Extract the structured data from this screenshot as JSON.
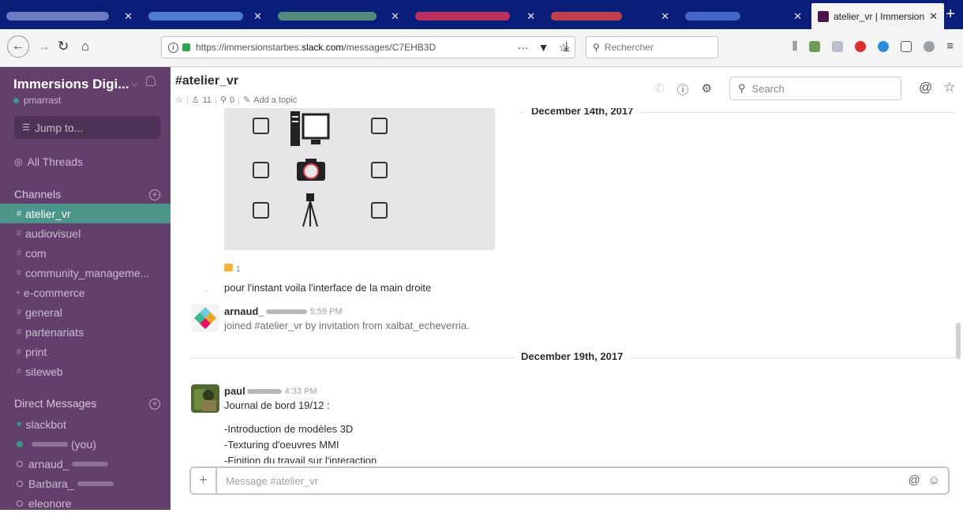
{
  "browser": {
    "active_tab_title": "atelier_vr | Immersion",
    "url_prefix": "https://immersionstarbes.",
    "url_host": "slack.com",
    "url_path": "/messages/C7EHB3D",
    "search_placeholder": "Rechercher"
  },
  "sidebar": {
    "team_name": "Immersions Digi...",
    "username": "pmarrast",
    "jump_label": "Jump to...",
    "threads_label": "All Threads",
    "channels_heading": "Channels",
    "channels": [
      {
        "name": "atelier_vr"
      },
      {
        "name": "audiovisuel"
      },
      {
        "name": "com"
      },
      {
        "name": "community_manageme..."
      },
      {
        "name": "e-commerce"
      },
      {
        "name": "general"
      },
      {
        "name": "partenariats"
      },
      {
        "name": "print"
      },
      {
        "name": "siteweb"
      }
    ],
    "dm_heading": "Direct Messages",
    "dms": [
      {
        "name": "slackbot"
      },
      {
        "name": "(you)"
      },
      {
        "name": "arnaud_"
      },
      {
        "name": "Barbara_"
      },
      {
        "name": "eleonore"
      }
    ]
  },
  "channel": {
    "title": "#atelier_vr",
    "members": "11",
    "pins": "0",
    "topic_label": "Add a topic",
    "search_placeholder": "Search"
  },
  "messages": {
    "divider_1": "December 14th, 2017",
    "reaction_count": "1",
    "text_1": "pour l'instant voila l'interface de la main droite",
    "msg_2": {
      "author": "arnaud_",
      "time": "5:59 PM",
      "text": "joined #atelier_vr by invitation from xalbat_echeverria."
    },
    "divider_2": "December 19th, 2017",
    "msg_3": {
      "author": "paul",
      "time": "4:33 PM",
      "line_1": "Journal de bord 19/12 :",
      "line_2": "-Introduction de modèles 3D",
      "line_3": "-Texturing d'oeuvres MMI",
      "line_4": "-Finition du travail sur l'interaction"
    }
  },
  "composer": {
    "placeholder": "Message #atelier_vr"
  },
  "colors": {
    "sidebar_bg": "#62406b",
    "active_channel": "#4c9689",
    "tabstrip_bg": "#0a1d78"
  }
}
